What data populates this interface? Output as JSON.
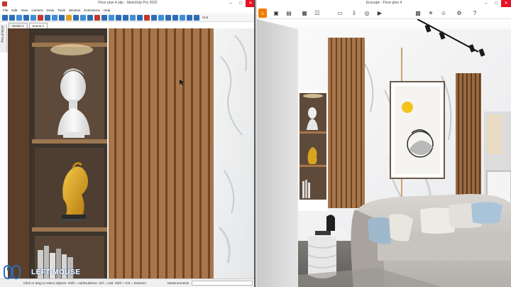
{
  "sketchup": {
    "title": "Floor plan 4.skp - SketchUp Pro 2022",
    "menu": [
      "File",
      "Edit",
      "View",
      "Camera",
      "Draw",
      "Tools",
      "Window",
      "Extensions",
      "Help"
    ],
    "unit_label": "Unit",
    "scenes": [
      "Scene 1",
      "Scene 2"
    ],
    "side_tab": "Default Tray",
    "status_hint": "Click or drag to select objects. Shift = Add/Subtract. Ctrl = Add. Shift + Ctrl = Subtract.",
    "measurements_label": "Measurements",
    "toolbar_colors": [
      "#2d6db5",
      "#2d6db5",
      "#3f8fd6",
      "#2d6db5",
      "#3f8fd6",
      "#c0392b",
      "#2d6db5",
      "#3f8fd6",
      "#2d6db5",
      "#e0a020",
      "#2d6db5",
      "#3f8fd6",
      "#2d6db5",
      "#c0392b",
      "#2d6db5",
      "#3f8fd6",
      "#2d6db5",
      "#2d6db5",
      "#3f8fd6",
      "#2d6db5",
      "#c0392b",
      "#2d6db5",
      "#3f8fd6",
      "#2d6db5",
      "#2d6db5",
      "#3f8fd6",
      "#2d6db5",
      "#2d6db5"
    ]
  },
  "enscape": {
    "title": "Enscape - Floor plan 4",
    "tool_icons": [
      "camera-icon",
      "bookmark-icon",
      "image-icon",
      "settings-icon",
      "monitor-icon",
      "export-icon",
      "panorama-icon",
      "video-icon",
      "asset-icon",
      "sun-icon",
      "user-icon",
      "gear-icon",
      "help-icon"
    ]
  },
  "watermark": {
    "text": "LEFT MOUSE"
  },
  "colors": {
    "accent_orange": "#f07c00",
    "close_red": "#e81123",
    "wood": "#a8764a",
    "wood_dark": "#7a4e2c",
    "shelf_dark": "#3d342c",
    "gold": "#d9a520"
  }
}
